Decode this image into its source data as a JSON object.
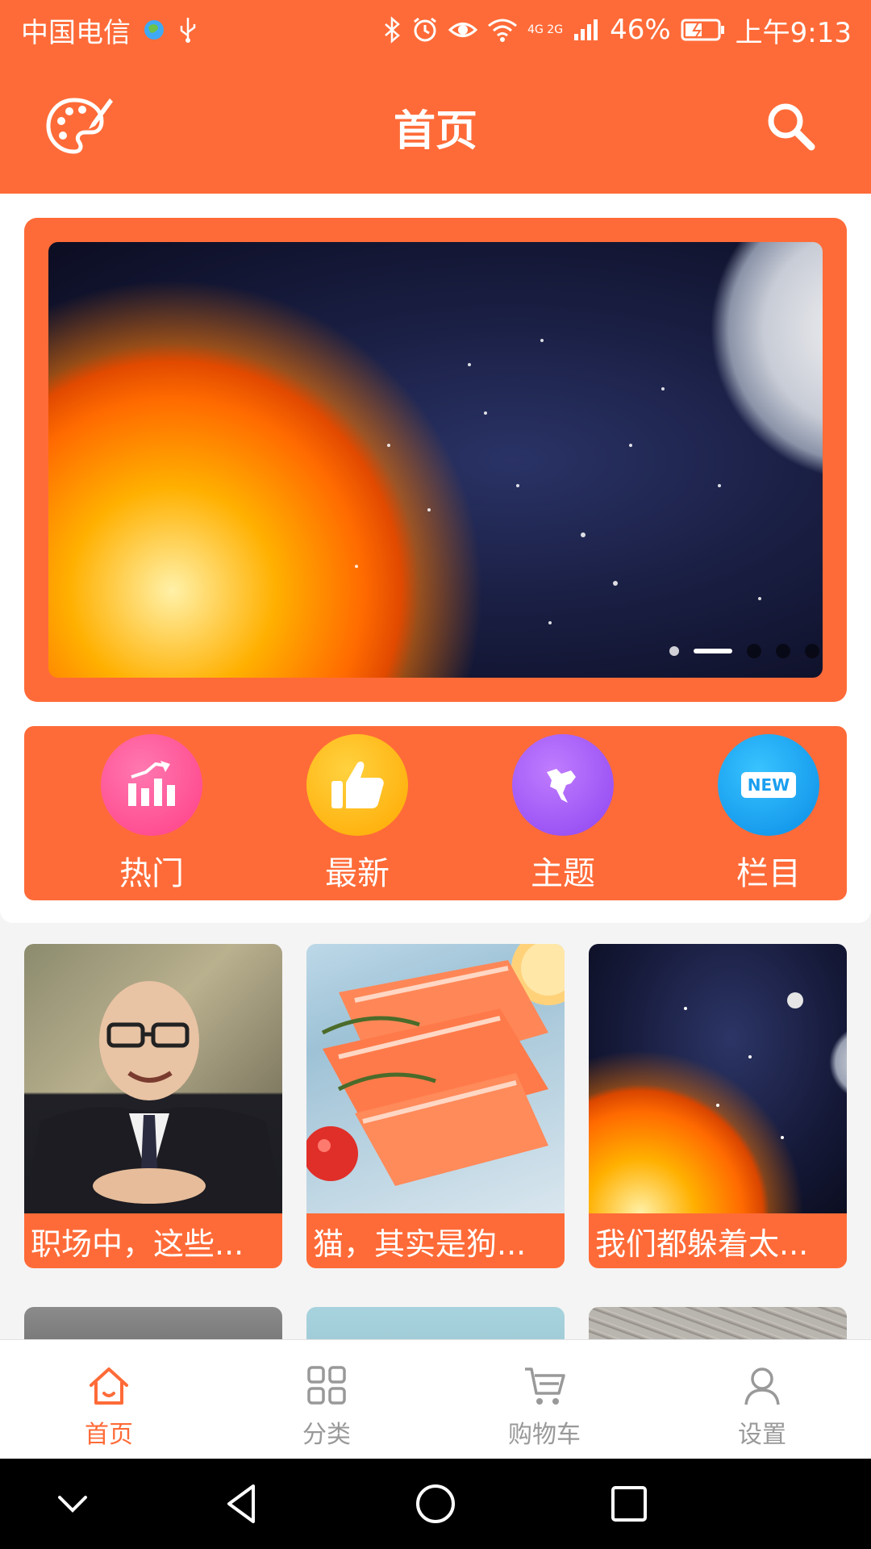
{
  "status_bar": {
    "carrier": "中国电信",
    "network": "4G 2G",
    "battery": "46%",
    "time": "上午9:13"
  },
  "header": {
    "title": "首页",
    "left_icon": "palette-icon",
    "right_icon": "search-icon"
  },
  "banner": {
    "slide_count": 5,
    "active_index": 1
  },
  "quick_menu": [
    {
      "label": "热门",
      "icon": "bar-chart-icon",
      "color": "#ff4f93"
    },
    {
      "label": "最新",
      "icon": "thumbs-up-icon",
      "color": "#ffb300"
    },
    {
      "label": "主题",
      "icon": "globe-icon",
      "color": "#9b57f5"
    },
    {
      "label": "栏目",
      "icon": "new-badge-icon",
      "color": "#1a9ff0",
      "badge": "NEW"
    }
  ],
  "cards": [
    {
      "title": "职场中，这些..."
    },
    {
      "title": "猫，其实是狗..."
    },
    {
      "title": "我们都躲着太..."
    }
  ],
  "tabbar": [
    {
      "label": "首页",
      "icon": "home-icon",
      "active": true
    },
    {
      "label": "分类",
      "icon": "grid-icon",
      "active": false
    },
    {
      "label": "购物车",
      "icon": "cart-icon",
      "active": false
    },
    {
      "label": "设置",
      "icon": "user-icon",
      "active": false
    }
  ],
  "colors": {
    "accent": "#ff6b38",
    "tab_inactive": "#999999"
  }
}
